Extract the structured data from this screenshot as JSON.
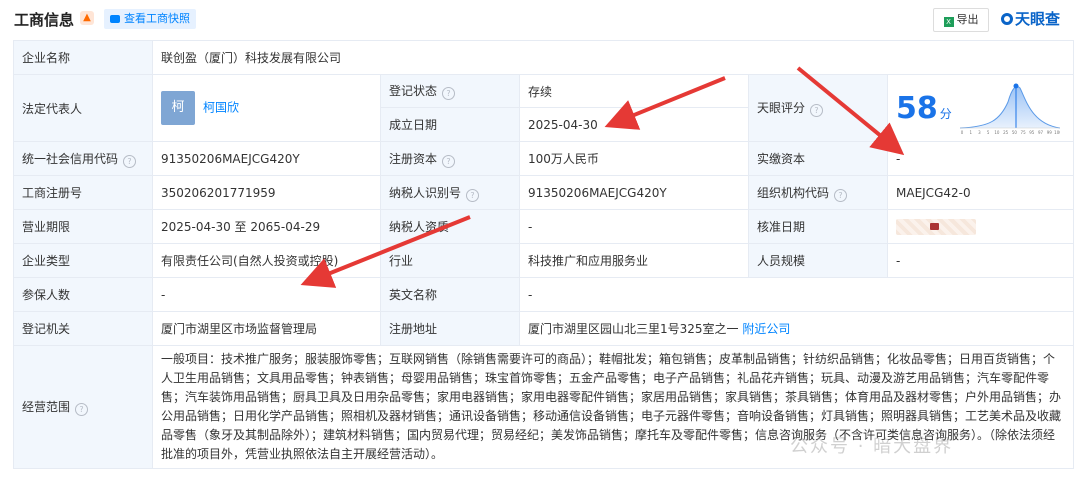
{
  "header": {
    "title": "工商信息",
    "snapshot_button": "查看工商快照",
    "export_button": "导出",
    "brand": "天眼查",
    "export_icon_text": "X"
  },
  "company_name": {
    "label": "企业名称",
    "value": "联创盈（厦门）科技发展有限公司"
  },
  "legal_rep": {
    "label": "法定代表人",
    "avatar": "柯",
    "name": "柯国欣"
  },
  "status": {
    "label": "登记状态",
    "value": "存续"
  },
  "founded": {
    "label": "成立日期",
    "value": "2025-04-30"
  },
  "score": {
    "label": "天眼评分",
    "value": "58",
    "unit": "分",
    "axis": [
      "0",
      "1",
      "3",
      "5",
      "10",
      "25",
      "50",
      "75",
      "95",
      "97",
      "99",
      "100"
    ]
  },
  "credit_code": {
    "label": "统一社会信用代码",
    "value": "91350206MAEJCG420Y"
  },
  "reg_capital": {
    "label": "注册资本",
    "value": "100万人民币"
  },
  "paid_capital": {
    "label": "实缴资本",
    "value": "-"
  },
  "reg_number": {
    "label": "工商注册号",
    "value": "350206201771959"
  },
  "taxpayer_id": {
    "label": "纳税人识别号",
    "value": "91350206MAEJCG420Y"
  },
  "org_code": {
    "label": "组织机构代码",
    "value": "MAEJCG42-0"
  },
  "term": {
    "label": "营业期限",
    "value": "2025-04-30 至 2065-04-29"
  },
  "taxpayer_qual": {
    "label": "纳税人资质",
    "value": "-"
  },
  "approve_date": {
    "label": "核准日期"
  },
  "company_type": {
    "label": "企业类型",
    "value": "有限责任公司(自然人投资或控股)"
  },
  "industry": {
    "label": "行业",
    "value": "科技推广和应用服务业"
  },
  "staff_size": {
    "label": "人员规模",
    "value": "-"
  },
  "insured": {
    "label": "参保人数",
    "value": "-"
  },
  "english_name": {
    "label": "英文名称",
    "value": "-"
  },
  "authority": {
    "label": "登记机关",
    "value": "厦门市湖里区市场监督管理局"
  },
  "address": {
    "label": "注册地址",
    "value": "厦门市湖里区园山北三里1号325室之一",
    "link": "附近公司"
  },
  "scope": {
    "label": "经营范围",
    "value": "一般项目：技术推广服务；服装服饰零售；互联网销售（除销售需要许可的商品）；鞋帽批发；箱包销售；皮革制品销售；针纺织品销售；化妆品零售；日用百货销售；个人卫生用品销售；文具用品零售；钟表销售；母婴用品销售；珠宝首饰零售；五金产品零售；电子产品销售；礼品花卉销售；玩具、动漫及游艺用品销售；汽车零配件零售；汽车装饰用品销售；厨具卫具及日用杂品零售；家用电器销售；家用电器零配件销售；家居用品销售；家具销售；茶具销售；体育用品及器材零售；户外用品销售；办公用品销售；日用化学产品销售；照相机及器材销售；通讯设备销售；移动通信设备销售；电子元器件零售；音响设备销售；灯具销售；照明器具销售；工艺美术品及收藏品零售（象牙及其制品除外）；建筑材料销售；国内贸易代理；贸易经纪；美发饰品销售；摩托车及零配件零售；信息咨询服务（不含许可类信息咨询服务）。（除依法须经批准的项目外，凭营业执照依法自主开展经营活动）。"
  },
  "watermark": "公众号 · 暗大盘界",
  "colors": {
    "accent": "#0084ff",
    "label_bg": "#f2f7fd",
    "arrow": "#e53935",
    "status_green": "#1a9e4f"
  }
}
